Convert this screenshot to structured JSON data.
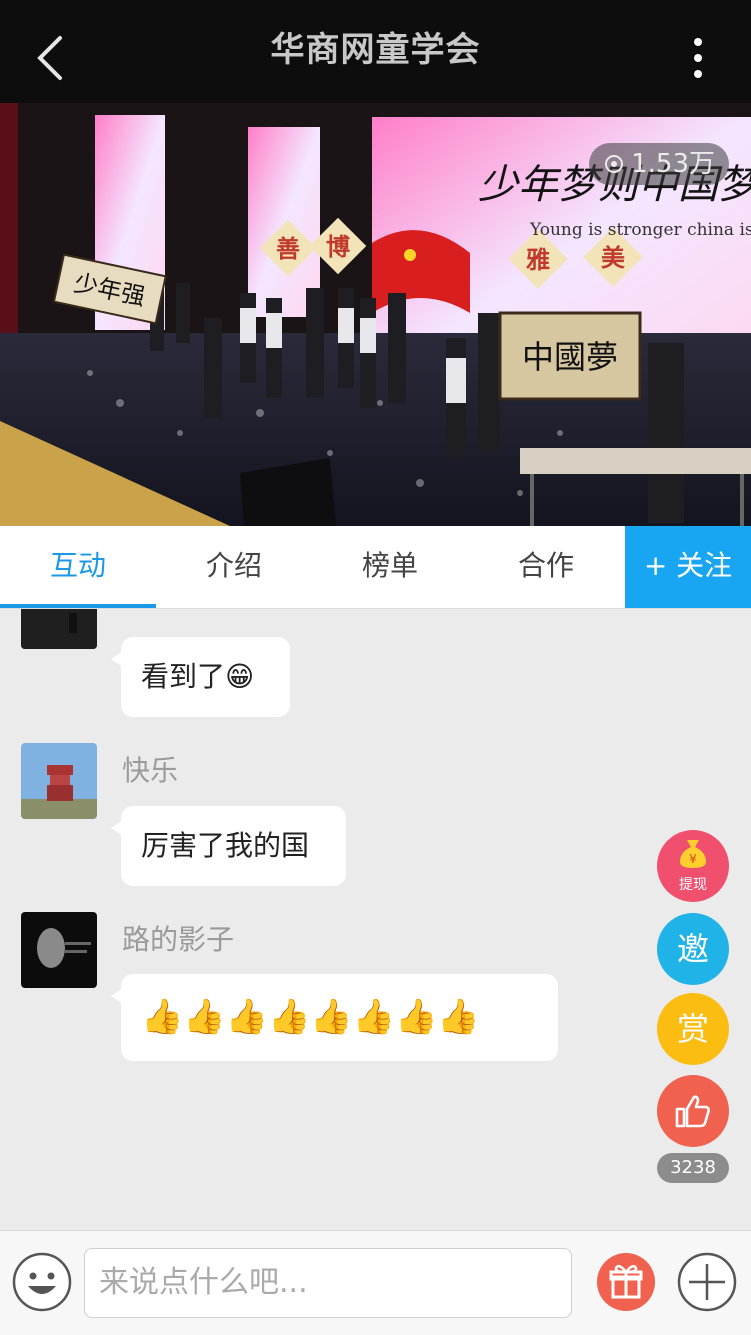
{
  "header": {
    "title": "华商网童学会"
  },
  "video": {
    "views": "1.53万",
    "stage": {
      "screen_title": "少年梦则中国梦",
      "screen_subtitle": "Young is stronger china is srtong",
      "sign_left": "少年强",
      "sign_right": "中國夢",
      "sign_tiles": [
        "善",
        "博",
        "雅",
        "美"
      ]
    }
  },
  "tabs": [
    {
      "label": "互动"
    },
    {
      "label": "介绍"
    },
    {
      "label": "榜单"
    },
    {
      "label": "合作"
    }
  ],
  "follow_label": "+ 关注",
  "messages": [
    {
      "name": "",
      "text": "看到了😁"
    },
    {
      "name": "快乐",
      "text": "厉害了我的国"
    },
    {
      "name": "路的影子",
      "text": "👍👍👍👍👍👍👍👍"
    }
  ],
  "fabs": {
    "withdraw_label": "提现",
    "invite_label": "邀",
    "reward_label": "赏",
    "likes_count": "3238"
  },
  "composer": {
    "placeholder": "来说点什么吧..."
  },
  "colors": {
    "accent": "#1a9ae6",
    "follow_bg": "#18a6f2",
    "withdraw": "#f0506e",
    "invite": "#1fb3e8",
    "reward": "#fbbd12",
    "like": "#f0624f"
  }
}
